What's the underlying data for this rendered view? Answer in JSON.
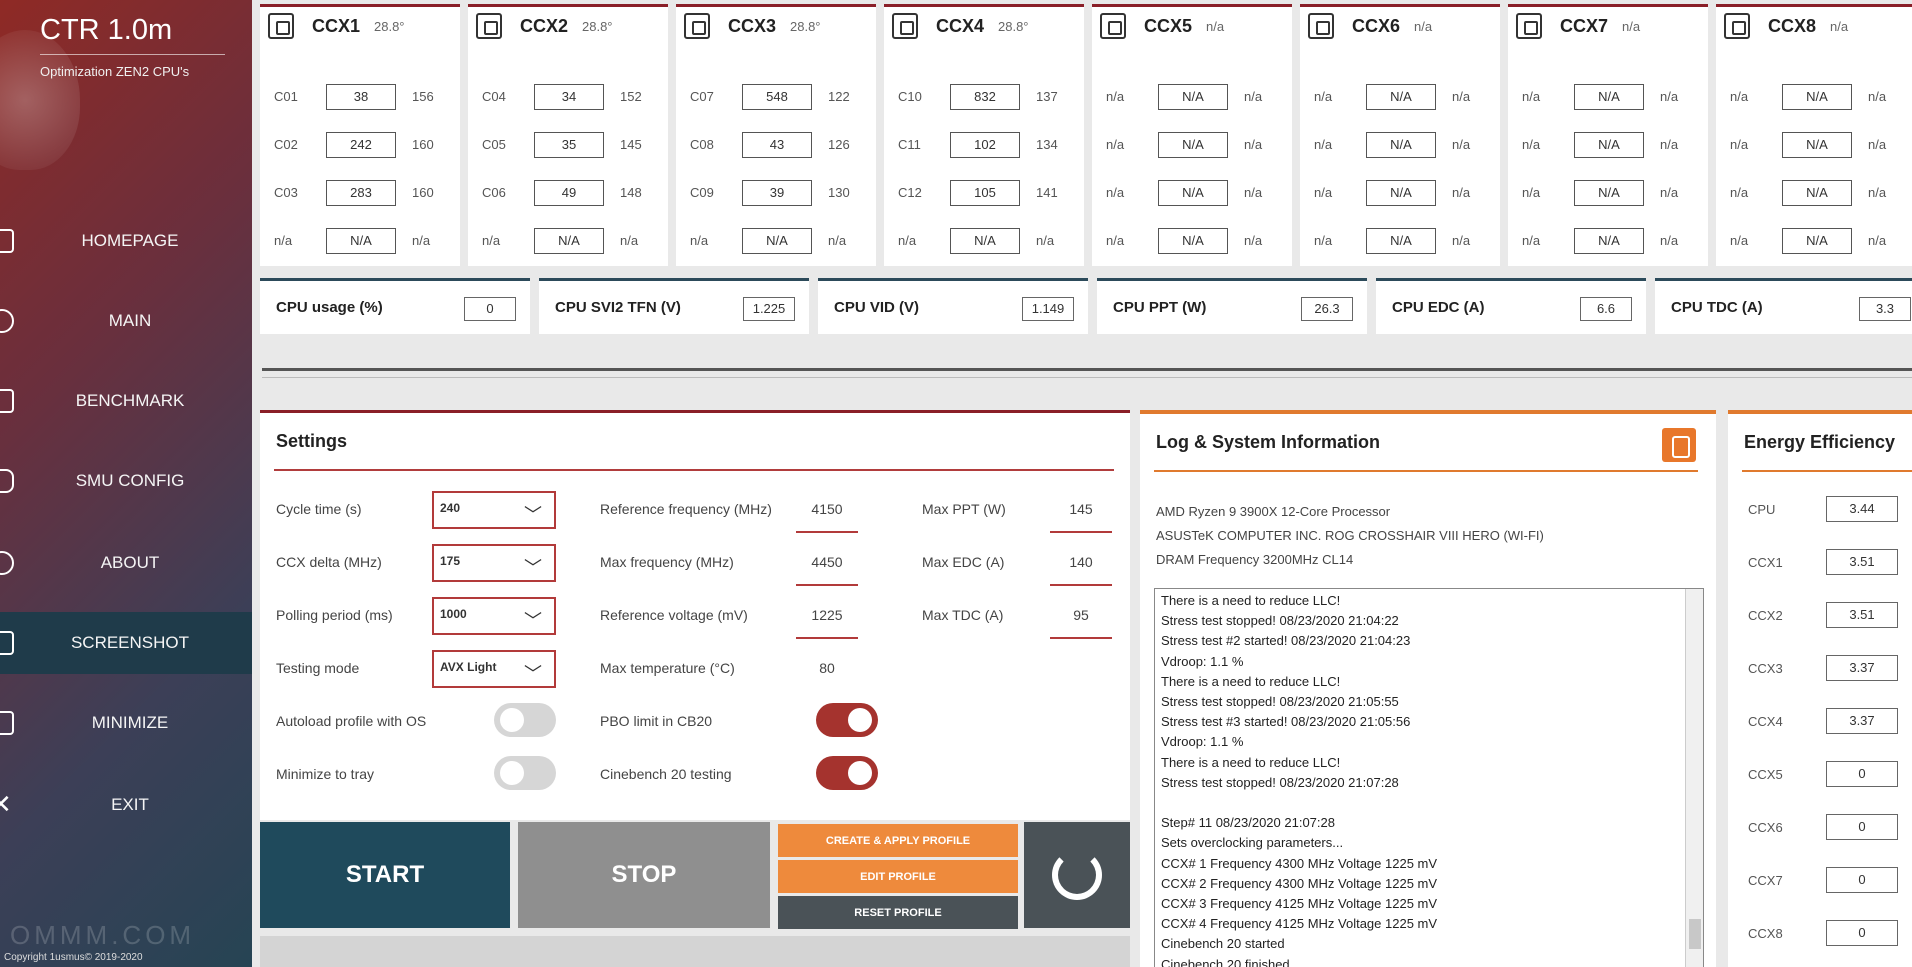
{
  "sidebar": {
    "brand": "CTR 1.0m",
    "subtitle": "Optimization ZEN2 CPU's",
    "items": [
      {
        "label": "HOMEPAGE"
      },
      {
        "label": "MAIN"
      },
      {
        "label": "BENCHMARK"
      },
      {
        "label": "SMU CONFIG"
      },
      {
        "label": "ABOUT"
      },
      {
        "label": "SCREENSHOT"
      },
      {
        "label": "MINIMIZE"
      },
      {
        "label": "EXIT"
      }
    ],
    "active_item": "SCREENSHOT",
    "watermark": "OMMM.COM",
    "copyright": "Copyright 1usmus© 2019-2020"
  },
  "ccx": [
    {
      "name": "CCX1",
      "temp": "28.8°",
      "cores": [
        {
          "id": "C01",
          "value": "38",
          "max": "156"
        },
        {
          "id": "C02",
          "value": "242",
          "max": "160"
        },
        {
          "id": "C03",
          "value": "283",
          "max": "160"
        },
        {
          "id": "n/a",
          "value": "N/A",
          "max": "n/a"
        }
      ]
    },
    {
      "name": "CCX2",
      "temp": "28.8°",
      "cores": [
        {
          "id": "C04",
          "value": "34",
          "max": "152"
        },
        {
          "id": "C05",
          "value": "35",
          "max": "145"
        },
        {
          "id": "C06",
          "value": "49",
          "max": "148"
        },
        {
          "id": "n/a",
          "value": "N/A",
          "max": "n/a"
        }
      ]
    },
    {
      "name": "CCX3",
      "temp": "28.8°",
      "cores": [
        {
          "id": "C07",
          "value": "548",
          "max": "122"
        },
        {
          "id": "C08",
          "value": "43",
          "max": "126"
        },
        {
          "id": "C09",
          "value": "39",
          "max": "130"
        },
        {
          "id": "n/a",
          "value": "N/A",
          "max": "n/a"
        }
      ]
    },
    {
      "name": "CCX4",
      "temp": "28.8°",
      "cores": [
        {
          "id": "C10",
          "value": "832",
          "max": "137"
        },
        {
          "id": "C11",
          "value": "102",
          "max": "134"
        },
        {
          "id": "C12",
          "value": "105",
          "max": "141"
        },
        {
          "id": "n/a",
          "value": "N/A",
          "max": "n/a"
        }
      ]
    },
    {
      "name": "CCX5",
      "temp": "n/a",
      "cores": [
        {
          "id": "n/a",
          "value": "N/A",
          "max": "n/a"
        },
        {
          "id": "n/a",
          "value": "N/A",
          "max": "n/a"
        },
        {
          "id": "n/a",
          "value": "N/A",
          "max": "n/a"
        },
        {
          "id": "n/a",
          "value": "N/A",
          "max": "n/a"
        }
      ]
    },
    {
      "name": "CCX6",
      "temp": "n/a",
      "cores": [
        {
          "id": "n/a",
          "value": "N/A",
          "max": "n/a"
        },
        {
          "id": "n/a",
          "value": "N/A",
          "max": "n/a"
        },
        {
          "id": "n/a",
          "value": "N/A",
          "max": "n/a"
        },
        {
          "id": "n/a",
          "value": "N/A",
          "max": "n/a"
        }
      ]
    },
    {
      "name": "CCX7",
      "temp": "n/a",
      "cores": [
        {
          "id": "n/a",
          "value": "N/A",
          "max": "n/a"
        },
        {
          "id": "n/a",
          "value": "N/A",
          "max": "n/a"
        },
        {
          "id": "n/a",
          "value": "N/A",
          "max": "n/a"
        },
        {
          "id": "n/a",
          "value": "N/A",
          "max": "n/a"
        }
      ]
    },
    {
      "name": "CCX8",
      "temp": "n/a",
      "cores": [
        {
          "id": "n/a",
          "value": "N/A",
          "max": "n/a"
        },
        {
          "id": "n/a",
          "value": "N/A",
          "max": "n/a"
        },
        {
          "id": "n/a",
          "value": "N/A",
          "max": "n/a"
        },
        {
          "id": "n/a",
          "value": "N/A",
          "max": "n/a"
        }
      ]
    }
  ],
  "metrics": [
    {
      "label": "CPU usage (%)",
      "value": "0"
    },
    {
      "label": "CPU SVI2 TFN (V)",
      "value": "1.225"
    },
    {
      "label": "CPU VID (V)",
      "value": "1.149"
    },
    {
      "label": "CPU PPT (W)",
      "value": "26.3"
    },
    {
      "label": "CPU EDC (A)",
      "value": "6.6"
    },
    {
      "label": "CPU TDC (A)",
      "value": "3.3"
    }
  ],
  "settings": {
    "title": "Settings",
    "cycle_time": {
      "label": "Cycle time (s)",
      "value": "240"
    },
    "ccx_delta": {
      "label": "CCX delta (MHz)",
      "value": "175"
    },
    "polling": {
      "label": "Polling period (ms)",
      "value": "1000"
    },
    "testing_mode": {
      "label": "Testing mode",
      "value": "AVX Light"
    },
    "autoload": {
      "label": "Autoload profile with OS",
      "on": false
    },
    "minimize_tray": {
      "label": "Minimize to tray",
      "on": false
    },
    "ref_freq": {
      "label": "Reference frequency (MHz)",
      "value": "4150"
    },
    "max_freq": {
      "label": "Max frequency (MHz)",
      "value": "4450"
    },
    "ref_volt": {
      "label": "Reference voltage (mV)",
      "value": "1225"
    },
    "max_temp": {
      "label": "Max temperature (°C)",
      "value": "80"
    },
    "pbo_limit": {
      "label": "PBO limit in CB20",
      "on": true
    },
    "cinebench": {
      "label": "Cinebench 20 testing",
      "on": true
    },
    "max_ppt": {
      "label": "Max PPT (W)",
      "value": "145"
    },
    "max_edc": {
      "label": "Max EDC (A)",
      "value": "140"
    },
    "max_tdc": {
      "label": "Max TDC (A)",
      "value": "95"
    }
  },
  "buttons": {
    "start": "START",
    "stop": "STOP",
    "create_apply": "CREATE & APPLY PROFILE",
    "edit": "EDIT PROFILE",
    "reset": "RESET PROFILE"
  },
  "log": {
    "title": "Log & System Information",
    "sysinfo": [
      "AMD Ryzen 9 3900X 12-Core Processor",
      "ASUSTeK COMPUTER INC. ROG CROSSHAIR VIII HERO (WI-FI)",
      "DRAM Frequency 3200MHz CL14"
    ],
    "lines": [
      "There is a need to reduce LLC!",
      "Stress test stopped!  08/23/2020 21:04:22",
      "Stress test #2 started!  08/23/2020 21:04:23",
      "Vdroop: 1.1 %",
      "There is a need to reduce LLC!",
      "Stress test stopped!  08/23/2020 21:05:55",
      "Stress test #3 started!  08/23/2020 21:05:56",
      "Vdroop: 1.1 %",
      "There is a need to reduce LLC!",
      "Stress test stopped!  08/23/2020 21:07:28",
      "",
      "Step# 11  08/23/2020 21:07:28",
      "Sets overclocking parameters...",
      "CCX# 1  Frequency 4300 MHz  Voltage 1225 mV",
      "CCX# 2  Frequency 4300 MHz  Voltage 1225 mV",
      "CCX# 3  Frequency 4125 MHz  Voltage 1225 mV",
      "CCX# 4  Frequency 4125 MHz  Voltage 1225 mV",
      "Cinebench 20 started",
      "Cinebench 20 finished"
    ]
  },
  "energy": {
    "title": "Energy Efficiency",
    "rows": [
      {
        "label": "CPU",
        "value": "3.44"
      },
      {
        "label": "CCX1",
        "value": "3.51"
      },
      {
        "label": "CCX2",
        "value": "3.51"
      },
      {
        "label": "CCX3",
        "value": "3.37"
      },
      {
        "label": "CCX4",
        "value": "3.37"
      },
      {
        "label": "CCX5",
        "value": "0"
      },
      {
        "label": "CCX6",
        "value": "0"
      },
      {
        "label": "CCX7",
        "value": "0"
      },
      {
        "label": "CCX8",
        "value": "0"
      }
    ]
  },
  "colors": {
    "accent_red": "#a5332e",
    "accent_orange": "#e8772b",
    "dark_teal": "#1f4a5c",
    "stop_gray": "#8f8f8f"
  }
}
